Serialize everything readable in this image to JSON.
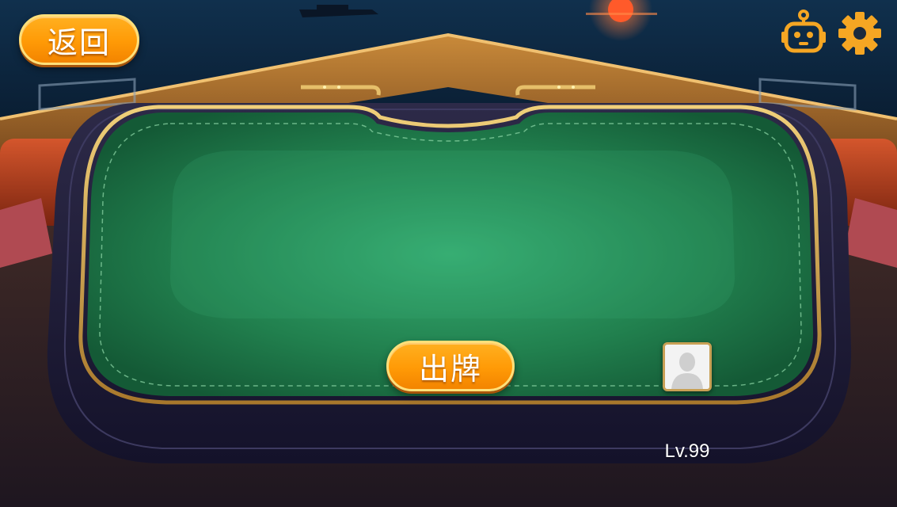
{
  "game": {
    "back_label": "返回",
    "play_label": "出牌",
    "player": {
      "level": "Lv.99"
    }
  },
  "icons": {
    "robot": "robot-icon",
    "settings": "gear-icon",
    "avatar": "user-placeholder-icon"
  },
  "colors": {
    "button_orange": "#ff9a06",
    "icon_gold": "#f5a623",
    "felt_green": "#2e9a62"
  }
}
